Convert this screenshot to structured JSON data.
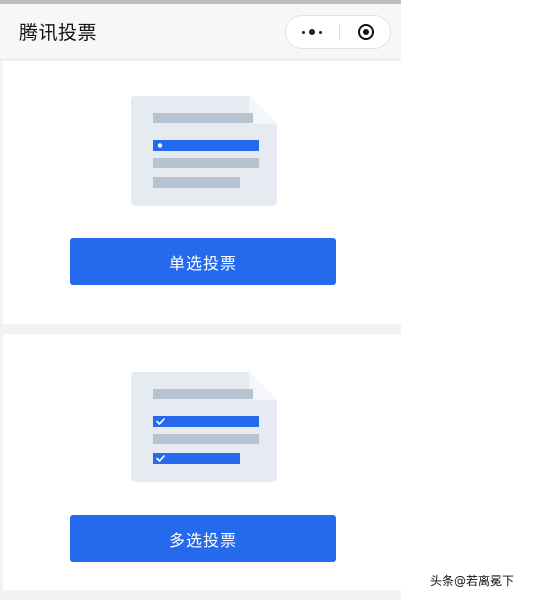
{
  "nav": {
    "title": "腾讯投票",
    "more_icon": "more-dots-icon",
    "close_icon": "target-close-icon"
  },
  "cards": [
    {
      "illustration": "single-choice-form-icon",
      "button_label": "单选投票"
    },
    {
      "illustration": "multi-choice-form-icon",
      "button_label": "多选投票"
    }
  ],
  "watermark": "头条@若离冕下",
  "colors": {
    "accent": "#2569ed",
    "doc_fill": "#e6ebf2",
    "doc_bar": "#b6c3d0",
    "page_bg": "#f2f2f2"
  }
}
